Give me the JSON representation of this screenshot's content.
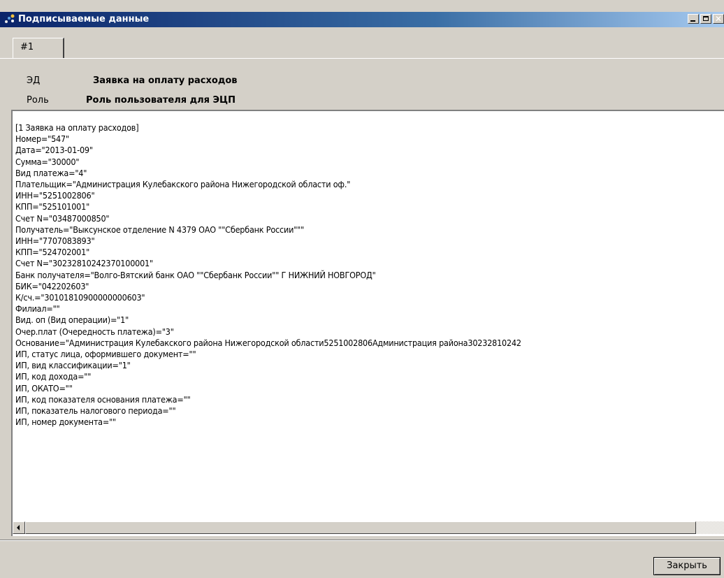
{
  "window": {
    "title": "Подписываемые данные"
  },
  "tabs": [
    {
      "label": "#1"
    }
  ],
  "header": {
    "ed_label": "ЭД",
    "ed_value": "Заявка на оплату расходов",
    "role_label": "Роль",
    "role_value": "Роль пользователя для ЭЦП"
  },
  "content": {
    "lines": [
      "[1 Заявка на оплату расходов]",
      "Номер=\"547\"",
      "Дата=\"2013-01-09\"",
      "Сумма=\"30000\"",
      "Вид платежа=\"4\"",
      "Плательщик=\"Администрация Кулебакского района Нижегородской области оф.\"",
      "ИНН=\"5251002806\"",
      "КПП=\"525101001\"",
      "Счет N=\"03487000850\"",
      "Получатель=\"Выксунское отделение N 4379 ОАО \"\"Сбербанк России\"\"\"",
      "ИНН=\"7707083893\"",
      "КПП=\"524702001\"",
      "Счет N=\"30232810242370100001\"",
      "Банк получателя=\"Волго-Вятский банк ОАО \"\"Сбербанк России\"\" Г НИЖНИЙ НОВГОРОД\"",
      "БИК=\"042202603\"",
      "К/сч.=\"30101810900000000603\"",
      "Филиал=\"\"",
      "Вид. оп (Вид операции)=\"1\"",
      "Очер.плат (Очередность платежа)=\"3\"",
      "Основание=\"Администрация Кулебакского района Нижегородской области5251002806Администрация района30232810242",
      "ИП, статус лица, оформившего документ=\"\"",
      "ИП, вид классификации=\"1\"",
      "ИП, код дохода=\"\"",
      "ИП, ОКАТО=\"\"",
      "ИП, код показателя основания платежа=\"\"",
      "ИП, показатель налогового периода=\"\"",
      "ИП, номер документа=\"\""
    ]
  },
  "footer": {
    "close_label": "Закрыть"
  }
}
